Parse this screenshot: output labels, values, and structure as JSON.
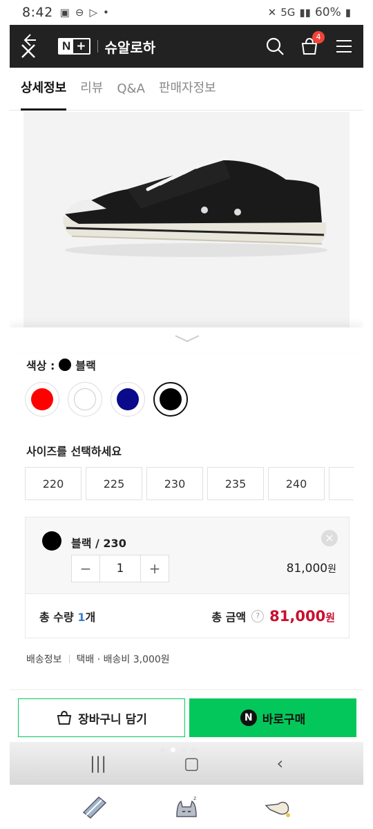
{
  "status": {
    "time": "8:42",
    "network": "5G",
    "battery": "60%"
  },
  "header": {
    "brand_n": "N",
    "brand_plus": "+",
    "store_name": "슈알로하",
    "cart_count": "4"
  },
  "tabs": [
    {
      "label": "상세정보",
      "active": true
    },
    {
      "label": "리뷰",
      "active": false
    },
    {
      "label": "Q&A",
      "active": false
    },
    {
      "label": "판매자정보",
      "active": false
    }
  ],
  "color": {
    "label": "색상 :",
    "selected_name": "블랙",
    "swatches": [
      {
        "name": "red",
        "hex": "#ff0000"
      },
      {
        "name": "white",
        "hex": "#ffffff"
      },
      {
        "name": "navy",
        "hex": "#0a0a8a"
      },
      {
        "name": "black",
        "hex": "#000000",
        "selected": true
      }
    ]
  },
  "size": {
    "title": "사이즈를 선택하세요",
    "options": [
      "220",
      "225",
      "230",
      "235",
      "240",
      "2"
    ]
  },
  "selected_option": {
    "name": "블랙 / 230",
    "quantity": "1",
    "price": "81,000",
    "currency": "원",
    "close": "×",
    "minus": "−",
    "plus": "+"
  },
  "total": {
    "qty_prefix": "총 수량 ",
    "qty_num": "1",
    "qty_suffix": "개",
    "label": "총 금액",
    "help": "?",
    "price": "81,000",
    "currency": "원"
  },
  "delivery": {
    "label": "배송정보",
    "info": "택배 · 배송비 3,000원"
  },
  "actions": {
    "cart_label": "장바구니 담기",
    "buy_label": "바로구매",
    "buy_logo": "N"
  },
  "colors": {
    "accent_green": "#03c75a",
    "price_red": "#c8102e",
    "header_bg": "#222222"
  }
}
